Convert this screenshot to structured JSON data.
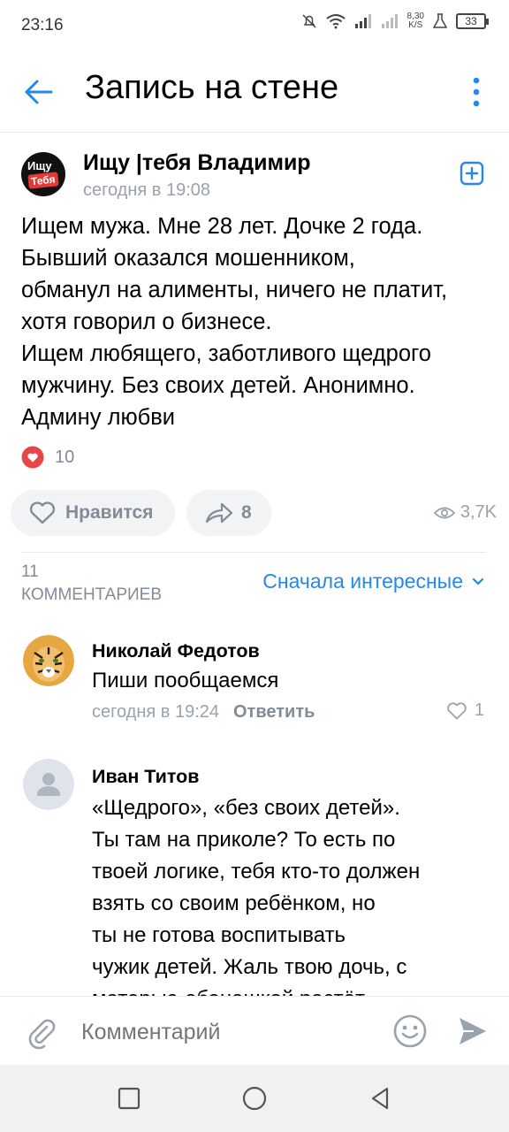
{
  "status_bar": {
    "time": "23:16",
    "net_speed_top": "8,30",
    "net_speed_unit": "K/S",
    "battery": "33"
  },
  "header": {
    "title": "Запись на стене",
    "back_icon": "arrow-left-icon",
    "menu_icon": "more-vertical-icon"
  },
  "post": {
    "group_name": "Ищу |тебя Владимир",
    "avatar_text_1": "Ищу",
    "avatar_text_2": "Тебя",
    "time": "сегодня в 19:08",
    "text_lines": [
      "Ищем мужа. Мне 28 лет. Дочке 2 года.",
      "Бывший оказался мошенником,",
      "обманул на алименты, ничего не платит,",
      "хотя говорил о бизнесе.",
      "Ищем любящего, заботливого щедрого",
      "мужчину. Без своих детей. Анонимно.",
      "Админу любви"
    ],
    "reaction_count": "10",
    "like_label": "Нравится",
    "share_count": "8",
    "views": "3,7K"
  },
  "comments_header": {
    "count": "11",
    "label": "КОММЕНТАРИЕВ",
    "sort": "Сначала интересные"
  },
  "comments": [
    {
      "author": "Николай Федотов",
      "text_lines": [
        "Пиши пообщаемся"
      ],
      "time": "сегодня в 19:24",
      "reply": "Ответить",
      "likes": "1"
    },
    {
      "author": "Иван Титов",
      "text_lines": [
        "«Щедрого», «без своих детей».",
        "Ты там на приколе? То есть по",
        "твоей логике, тебя кто-то должен",
        "взять со своим ребёнком, но",
        "ты не готова воспитывать",
        "чужик детей. Жаль твою дочь, с",
        "матерью-ебанашкой растёт"
      ]
    }
  ],
  "composer": {
    "placeholder": "Комментарий"
  },
  "colors": {
    "accent": "#2688eb",
    "like_red": "#e64646",
    "muted": "#818c99",
    "bg_button": "#f2f3f5"
  }
}
